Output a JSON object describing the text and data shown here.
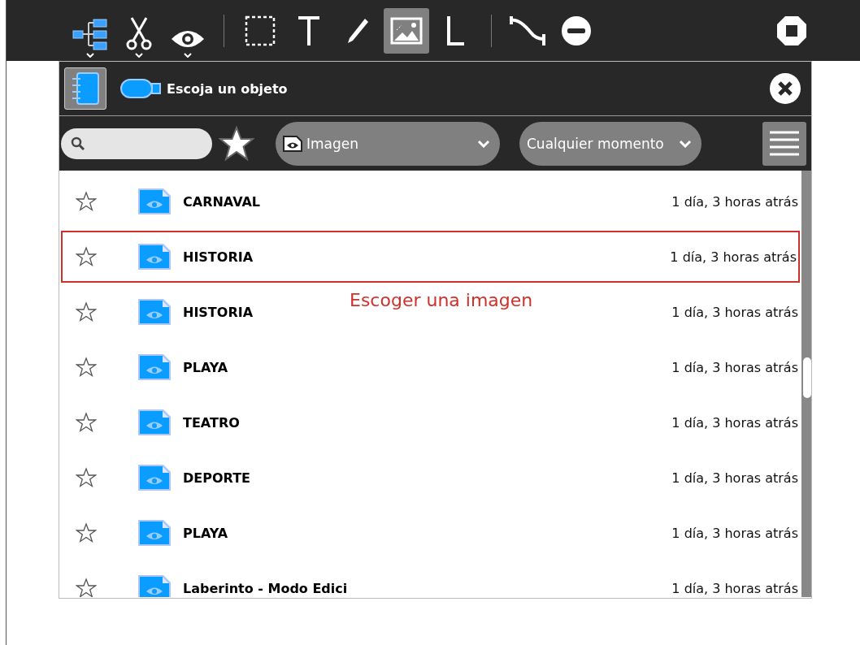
{
  "toolbar": {
    "tools": [
      {
        "kind": "tree",
        "menu": true,
        "selected": false
      },
      {
        "kind": "scissors",
        "menu": true,
        "selected": false
      },
      {
        "kind": "eye",
        "menu": true,
        "selected": false
      },
      {
        "kind": "separator"
      },
      {
        "kind": "rect",
        "menu": false,
        "selected": false
      },
      {
        "kind": "text",
        "menu": false,
        "selected": false
      },
      {
        "kind": "pencil",
        "menu": false,
        "selected": false
      },
      {
        "kind": "image",
        "menu": false,
        "selected": true
      },
      {
        "kind": "line",
        "menu": false,
        "selected": false
      },
      {
        "kind": "separator"
      },
      {
        "kind": "connector",
        "menu": false,
        "selected": false
      },
      {
        "kind": "minus",
        "menu": false,
        "selected": false
      }
    ]
  },
  "dialog": {
    "title": "Escoja un objeto",
    "filters": {
      "type": "Imagen",
      "time": "Cualquier momento"
    },
    "rows": [
      {
        "title": "CARNAVAL",
        "time": "1 día, 3 horas atrás",
        "starred": false,
        "outlined": false
      },
      {
        "title": "HISTORIA",
        "time": "1 día, 3 horas atrás",
        "starred": false,
        "outlined": true
      },
      {
        "title": "HISTORIA",
        "time": "1 día, 3 horas atrás",
        "starred": false,
        "outlined": false
      },
      {
        "title": "PLAYA",
        "time": "1 día, 3 horas atrás",
        "starred": false,
        "outlined": false
      },
      {
        "title": "TEATRO",
        "time": "1 día, 3 horas atrás",
        "starred": false,
        "outlined": false
      },
      {
        "title": "DEPORTE",
        "time": "1 día, 3 horas atrás",
        "starred": false,
        "outlined": false
      },
      {
        "title": "PLAYA",
        "time": "1 día, 3 horas atrás",
        "starred": false,
        "outlined": false
      },
      {
        "title": "Laberinto - Modo Edici",
        "time": "1 día, 3 horas atrás",
        "starred": false,
        "outlined": false
      }
    ]
  },
  "annotation": {
    "text": "Escoger una imagen"
  }
}
